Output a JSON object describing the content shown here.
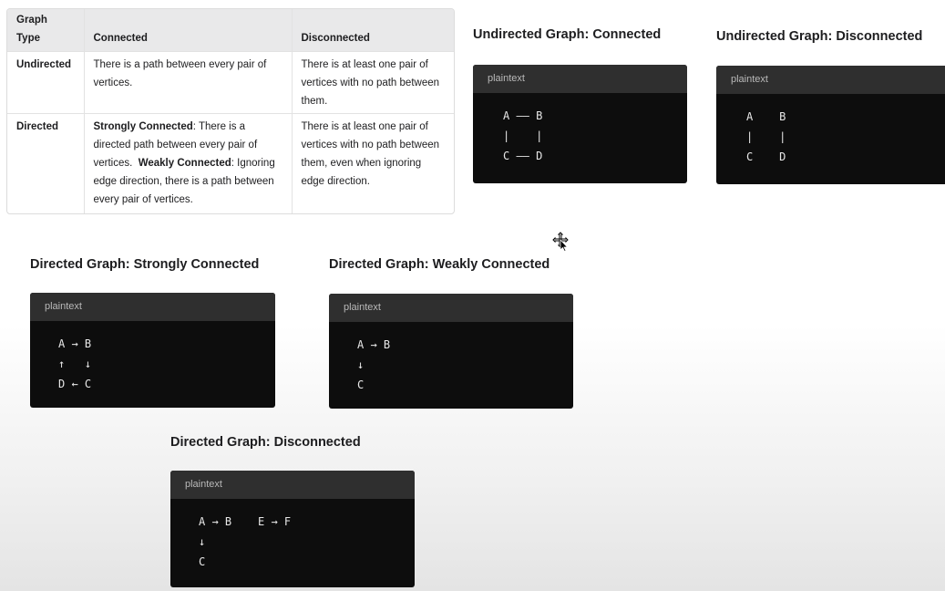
{
  "table": {
    "headers": [
      "Graph\nType",
      "Connected",
      "Disconnected"
    ],
    "rows": [
      {
        "type": "Undirected",
        "connected": "There is a path between every pair of vertices.",
        "disconnected": "There is at least one pair of vertices with no path between them."
      },
      {
        "type": "Directed",
        "strong_label": "Strongly Connected",
        "strong_text": ": There is a directed path between every pair of vertices.",
        "weak_label": "Weakly Connected",
        "weak_text": ": Ignoring edge direction, there is a path between every pair of vertices.",
        "disconnected": "There is at least one pair of vertices with no path between them, even when ignoring edge direction."
      }
    ]
  },
  "sections": {
    "undirected_connected": {
      "title": "Undirected Graph: Connected",
      "lang": "plaintext",
      "code": "A —— B\n|    |\nC —— D"
    },
    "undirected_disconnected": {
      "title": "Undirected Graph: Disconnected",
      "lang": "plaintext",
      "code": "A    B\n|    |\nC    D"
    },
    "directed_strong": {
      "title": "Directed Graph: Strongly Connected",
      "lang": "plaintext",
      "code": "A → B\n↑   ↓\nD ← C"
    },
    "directed_weak": {
      "title": "Directed Graph: Weakly Connected",
      "lang": "plaintext",
      "code": "A → B\n↓\nC"
    },
    "directed_disconnected": {
      "title": "Directed Graph: Disconnected",
      "lang": "plaintext",
      "code": "A → B    E → F\n↓\nC"
    }
  },
  "cursor_icon": "move-cursor-icon"
}
